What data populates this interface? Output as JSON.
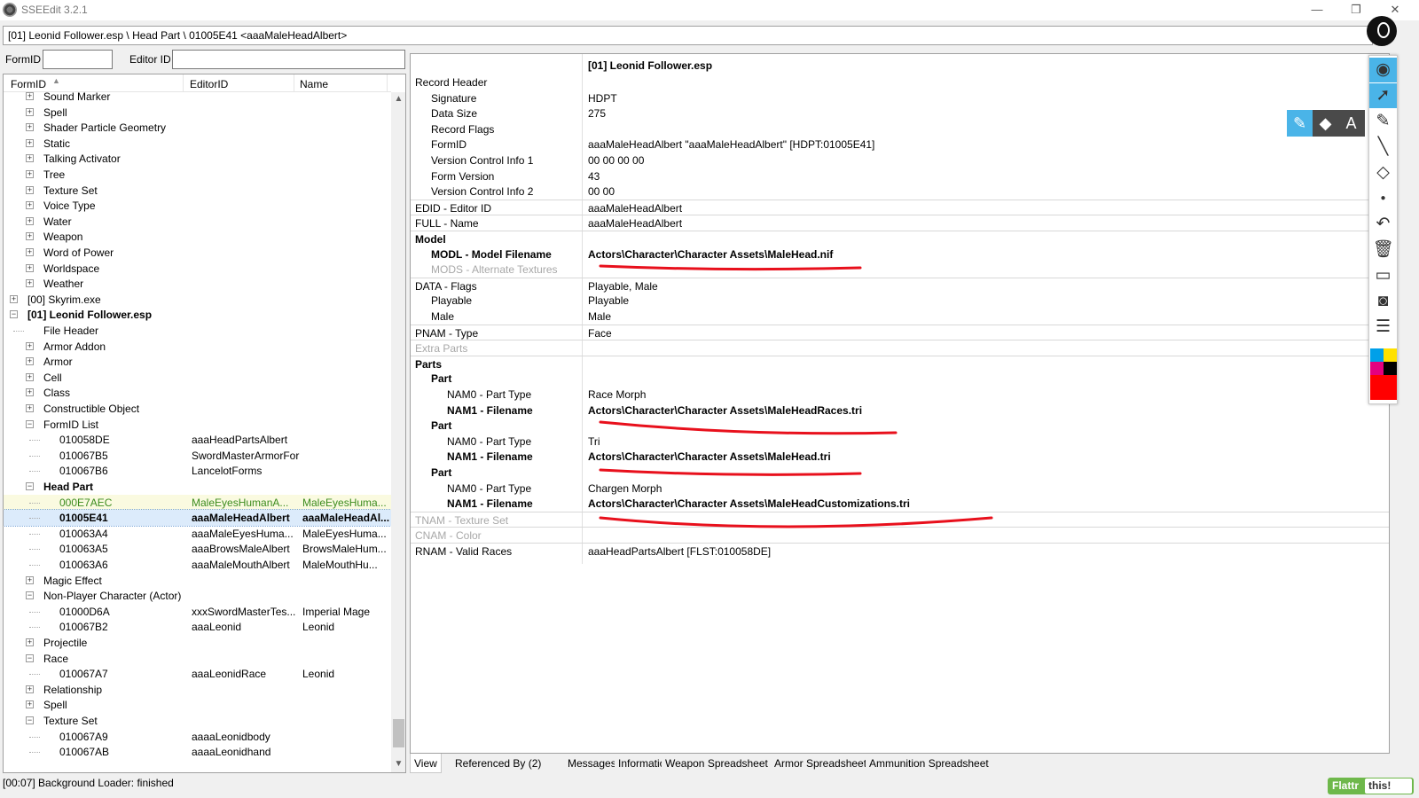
{
  "window": {
    "title": "SSEEdit 3.2.1",
    "minimize": "—",
    "restore": "❐",
    "close": "✕"
  },
  "path": "[01] Leonid Follower.esp \\ Head Part \\ 01005E41 <aaaMaleHeadAlbert>",
  "filter": {
    "formid_label": "FormID",
    "editorid_label": "Editor ID",
    "formid_value": "",
    "editorid_value": ""
  },
  "tree": {
    "headers": [
      "FormID",
      "EditorID",
      "Name"
    ],
    "rows": [
      {
        "level": 1,
        "exp": "+",
        "c1": "Sound Marker",
        "c2": "",
        "c3": ""
      },
      {
        "level": 1,
        "exp": "+",
        "c1": "Spell",
        "c2": "",
        "c3": ""
      },
      {
        "level": 1,
        "exp": "+",
        "c1": "Shader Particle Geometry",
        "c2": "",
        "c3": ""
      },
      {
        "level": 1,
        "exp": "+",
        "c1": "Static",
        "c2": "",
        "c3": ""
      },
      {
        "level": 1,
        "exp": "+",
        "c1": "Talking Activator",
        "c2": "",
        "c3": ""
      },
      {
        "level": 1,
        "exp": "+",
        "c1": "Tree",
        "c2": "",
        "c3": ""
      },
      {
        "level": 1,
        "exp": "+",
        "c1": "Texture Set",
        "c2": "",
        "c3": ""
      },
      {
        "level": 1,
        "exp": "+",
        "c1": "Voice Type",
        "c2": "",
        "c3": ""
      },
      {
        "level": 1,
        "exp": "+",
        "c1": "Water",
        "c2": "",
        "c3": ""
      },
      {
        "level": 1,
        "exp": "+",
        "c1": "Weapon",
        "c2": "",
        "c3": ""
      },
      {
        "level": 1,
        "exp": "+",
        "c1": "Word of Power",
        "c2": "",
        "c3": ""
      },
      {
        "level": 1,
        "exp": "+",
        "c1": "Worldspace",
        "c2": "",
        "c3": ""
      },
      {
        "level": 1,
        "exp": "+",
        "c1": "Weather",
        "c2": "",
        "c3": ""
      },
      {
        "level": 0,
        "exp": "+",
        "c1": "[00] Skyrim.exe",
        "c2": "",
        "c3": ""
      },
      {
        "level": 0,
        "exp": "−",
        "c1": "[01] Leonid Follower.esp",
        "c2": "",
        "c3": "",
        "bold": true
      },
      {
        "level": 1,
        "exp": "",
        "c1": "File Header",
        "c2": "",
        "c3": ""
      },
      {
        "level": 1,
        "exp": "+",
        "c1": "Armor Addon",
        "c2": "",
        "c3": ""
      },
      {
        "level": 1,
        "exp": "+",
        "c1": "Armor",
        "c2": "",
        "c3": ""
      },
      {
        "level": 1,
        "exp": "+",
        "c1": "Cell",
        "c2": "",
        "c3": ""
      },
      {
        "level": 1,
        "exp": "+",
        "c1": "Class",
        "c2": "",
        "c3": ""
      },
      {
        "level": 1,
        "exp": "+",
        "c1": "Constructible Object",
        "c2": "",
        "c3": ""
      },
      {
        "level": 1,
        "exp": "−",
        "c1": "FormID List",
        "c2": "",
        "c3": ""
      },
      {
        "level": 2,
        "exp": "",
        "c1": "010058DE",
        "c2": "aaaHeadPartsAlbert",
        "c3": ""
      },
      {
        "level": 2,
        "exp": "",
        "c1": "010067B5",
        "c2": "SwordMasterArmorForms",
        "c3": ""
      },
      {
        "level": 2,
        "exp": "",
        "c1": "010067B6",
        "c2": "LancelotForms",
        "c3": ""
      },
      {
        "level": 1,
        "exp": "−",
        "c1": "Head Part",
        "c2": "",
        "c3": "",
        "bold": true
      },
      {
        "level": 2,
        "exp": "",
        "c1": "000E7AEC",
        "c2": "MaleEyesHumanA...",
        "c3": "MaleEyesHuma...",
        "green": true
      },
      {
        "level": 2,
        "exp": "",
        "c1": "01005E41",
        "c2": "aaaMaleHeadAlbert",
        "c3": "aaaMaleHeadAl...",
        "bold": true,
        "sel": true
      },
      {
        "level": 2,
        "exp": "",
        "c1": "010063A4",
        "c2": "aaaMaleEyesHuma...",
        "c3": "MaleEyesHuma..."
      },
      {
        "level": 2,
        "exp": "",
        "c1": "010063A5",
        "c2": "aaaBrowsMaleAlbert",
        "c3": "BrowsMaleHum..."
      },
      {
        "level": 2,
        "exp": "",
        "c1": "010063A6",
        "c2": "aaaMaleMouthAlbert",
        "c3": "MaleMouthHu..."
      },
      {
        "level": 1,
        "exp": "+",
        "c1": "Magic Effect",
        "c2": "",
        "c3": ""
      },
      {
        "level": 1,
        "exp": "−",
        "c1": "Non-Player Character (Actor)",
        "c2": "",
        "c3": ""
      },
      {
        "level": 2,
        "exp": "",
        "c1": "01000D6A",
        "c2": "xxxSwordMasterTes...",
        "c3": "Imperial Mage"
      },
      {
        "level": 2,
        "exp": "",
        "c1": "010067B2",
        "c2": "aaaLeonid",
        "c3": "Leonid"
      },
      {
        "level": 1,
        "exp": "+",
        "c1": "Projectile",
        "c2": "",
        "c3": ""
      },
      {
        "level": 1,
        "exp": "−",
        "c1": "Race",
        "c2": "",
        "c3": ""
      },
      {
        "level": 2,
        "exp": "",
        "c1": "010067A7",
        "c2": "aaaLeonidRace",
        "c3": "Leonid"
      },
      {
        "level": 1,
        "exp": "+",
        "c1": "Relationship",
        "c2": "",
        "c3": ""
      },
      {
        "level": 1,
        "exp": "+",
        "c1": "Spell",
        "c2": "",
        "c3": ""
      },
      {
        "level": 1,
        "exp": "−",
        "c1": "Texture Set",
        "c2": "",
        "c3": ""
      },
      {
        "level": 2,
        "exp": "",
        "c1": "010067A9",
        "c2": "aaaaLeonidbody",
        "c3": ""
      },
      {
        "level": 2,
        "exp": "",
        "c1": "010067AB",
        "c2": "aaaaLeonidhand",
        "c3": ""
      }
    ]
  },
  "view": {
    "file_header": "[01] Leonid Follower.esp",
    "rows": [
      {
        "indent": 0,
        "k": "Record Header",
        "v": ""
      },
      {
        "indent": 1,
        "k": "Signature",
        "v": "HDPT"
      },
      {
        "indent": 1,
        "k": "Data Size",
        "v": "275"
      },
      {
        "indent": 1,
        "k": "Record Flags",
        "v": ""
      },
      {
        "indent": 1,
        "k": "FormID",
        "v": "aaaMaleHeadAlbert \"aaaMaleHeadAlbert\" [HDPT:01005E41]"
      },
      {
        "indent": 1,
        "k": "Version Control Info 1",
        "v": "00 00 00 00"
      },
      {
        "indent": 1,
        "k": "Form Version",
        "v": "43"
      },
      {
        "indent": 1,
        "k": "Version Control Info 2",
        "v": "00 00"
      },
      {
        "indent": 0,
        "k": "EDID - Editor ID",
        "v": "aaaMaleHeadAlbert",
        "line": true
      },
      {
        "indent": 0,
        "k": "FULL - Name",
        "v": "aaaMaleHeadAlbert",
        "line": true
      },
      {
        "indent": 0,
        "k": "Model",
        "v": "",
        "bold": true,
        "line": true
      },
      {
        "indent": 1,
        "k": "MODL - Model Filename",
        "v": "Actors\\Character\\Character Assets\\MaleHead.nif",
        "bold": true
      },
      {
        "indent": 1,
        "k": "MODS - Alternate Textures",
        "v": "",
        "grey": true
      },
      {
        "indent": 0,
        "k": "DATA - Flags",
        "v": "Playable, Male",
        "line": true
      },
      {
        "indent": 1,
        "k": "Playable",
        "v": "Playable"
      },
      {
        "indent": 1,
        "k": "Male",
        "v": "Male"
      },
      {
        "indent": 0,
        "k": "PNAM - Type",
        "v": "Face",
        "line": true
      },
      {
        "indent": 0,
        "k": "Extra Parts",
        "v": "",
        "grey": true,
        "line": true
      },
      {
        "indent": 0,
        "k": "Parts",
        "v": "",
        "bold": true,
        "line": true
      },
      {
        "indent": 1,
        "k": "Part",
        "v": "",
        "bold": true
      },
      {
        "indent": 2,
        "k": "NAM0 - Part Type",
        "v": "Race Morph"
      },
      {
        "indent": 2,
        "k": "NAM1 - Filename",
        "v": "Actors\\Character\\Character Assets\\MaleHeadRaces.tri",
        "bold": true
      },
      {
        "indent": 1,
        "k": "Part",
        "v": "",
        "bold": true
      },
      {
        "indent": 2,
        "k": "NAM0 - Part Type",
        "v": "Tri"
      },
      {
        "indent": 2,
        "k": "NAM1 - Filename",
        "v": "Actors\\Character\\Character Assets\\MaleHead.tri",
        "bold": true
      },
      {
        "indent": 1,
        "k": "Part",
        "v": "",
        "bold": true
      },
      {
        "indent": 2,
        "k": "NAM0 - Part Type",
        "v": "Chargen Morph"
      },
      {
        "indent": 2,
        "k": "NAM1 - Filename",
        "v": "Actors\\Character\\Character Assets\\MaleHeadCustomizations.tri",
        "bold": true
      },
      {
        "indent": 0,
        "k": "TNAM - Texture Set",
        "v": "",
        "grey": true,
        "line": true
      },
      {
        "indent": 0,
        "k": "CNAM - Color",
        "v": "",
        "grey": true,
        "line": true
      },
      {
        "indent": 0,
        "k": "RNAM - Valid Races",
        "v": "aaaHeadPartsAlbert [FLST:010058DE]",
        "line": true
      }
    ]
  },
  "tabs": [
    "View",
    "Referenced By (2)",
    "Messages",
    "Information",
    "Weapon Spreadsheet",
    "Armor Spreadsheet",
    "Ammunition Spreadsheet"
  ],
  "status": "[00:07] Background Loader: finished",
  "flattr": {
    "label": "Flattr",
    "this": "this!"
  },
  "annotation_tool": {
    "popup_text_tool": "A",
    "colors": [
      "#00a0e9",
      "#ffe100",
      "#e4007f",
      "#000000",
      "#ff0000",
      "#ff0000"
    ]
  }
}
